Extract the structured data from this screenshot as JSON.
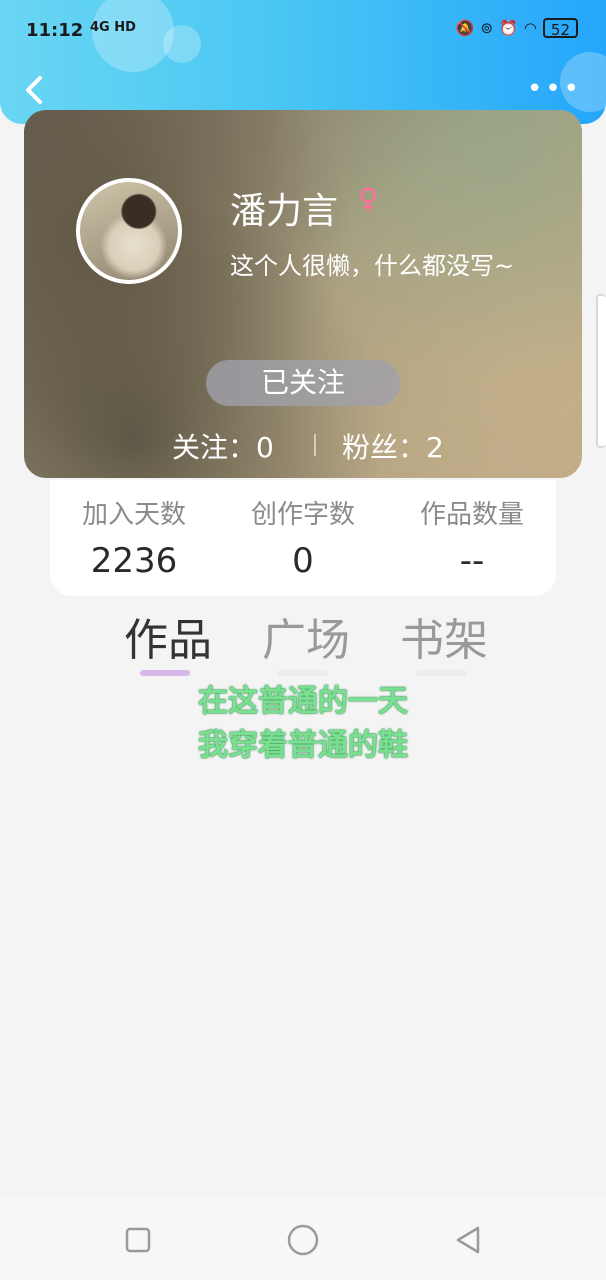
{
  "status_bar": {
    "time": "11:12",
    "network": "4G HD",
    "battery": "52"
  },
  "profile": {
    "username": "潘力言",
    "gender_symbol": "♀",
    "bio": "这个人很懒，什么都没写~",
    "follow_button_label": "已关注",
    "following_text": "关注：0",
    "followers_text": "粉丝：2"
  },
  "stats": [
    {
      "label": "加入天数",
      "value": "2236"
    },
    {
      "label": "创作字数",
      "value": "0"
    },
    {
      "label": "作品数量",
      "value": "--"
    }
  ],
  "tabs": [
    {
      "label": "作品",
      "active": true
    },
    {
      "label": "广场",
      "active": false
    },
    {
      "label": "书架",
      "active": false
    }
  ],
  "empty_message": {
    "line1": "在这普通的一天",
    "line2": "我穿着普通的鞋"
  },
  "colors": {
    "header_start": "#6ad6f3",
    "header_end": "#25a6fb",
    "active_tab_underline": "#d8b7ea",
    "empty_text": "#78e08f",
    "gender": "#ff6f9c"
  },
  "icons": {
    "back": "chevron-left-icon",
    "more": "more-dots-icon",
    "nav_recent": "square-icon",
    "nav_home": "circle-icon",
    "nav_back": "triangle-back-icon"
  }
}
